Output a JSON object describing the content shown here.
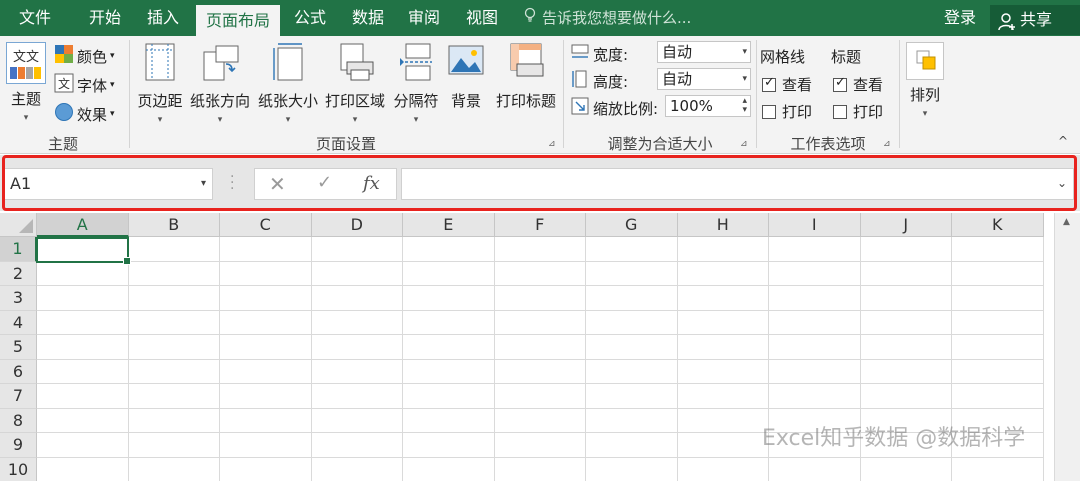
{
  "tabs": [
    {
      "label": "文件",
      "active": false
    },
    {
      "label": "开始",
      "active": false
    },
    {
      "label": "插入",
      "active": false
    },
    {
      "label": "页面布局",
      "active": true
    },
    {
      "label": "公式",
      "active": false
    },
    {
      "label": "数据",
      "active": false
    },
    {
      "label": "审阅",
      "active": false
    },
    {
      "label": "视图",
      "active": false
    }
  ],
  "tell_me": "告诉我您想要做什么...",
  "login": "登录",
  "share": "共享",
  "ribbon": {
    "themes": {
      "theme_label": "主题",
      "colors_label": "颜色",
      "fonts_label": "字体",
      "effects_label": "效果",
      "group_label": "主题",
      "theme_icon_text": "文文"
    },
    "page_setup": {
      "buttons": [
        "页边距",
        "纸张方向",
        "纸张大小",
        "打印区域",
        "分隔符",
        "背景",
        "打印标题"
      ],
      "group_label": "页面设置"
    },
    "scale_to_fit": {
      "width_label": "宽度:",
      "width_value": "自动",
      "height_label": "高度:",
      "height_value": "自动",
      "scale_label": "缩放比例:",
      "scale_value": "100%",
      "group_label": "调整为合适大小"
    },
    "sheet_options": {
      "gridlines_label": "网格线",
      "headings_label": "标题",
      "gridlines_view": "查看",
      "gridlines_print": "打印",
      "headings_view": "查看",
      "headings_print": "打印",
      "gridlines_view_checked": true,
      "gridlines_print_checked": false,
      "headings_view_checked": true,
      "headings_print_checked": false,
      "group_label": "工作表选项"
    },
    "arrange": {
      "label": "排列"
    }
  },
  "formula_bar": {
    "name_box": "A1",
    "formula": ""
  },
  "columns": [
    "A",
    "B",
    "C",
    "D",
    "E",
    "F",
    "G",
    "H",
    "I",
    "J",
    "K"
  ],
  "rows": [
    "1",
    "2",
    "3",
    "4",
    "5",
    "6",
    "7",
    "8",
    "9",
    "10"
  ],
  "active_cell": "A1",
  "colors": {
    "accent": "#217346",
    "highlight_frame": "#e8231e"
  },
  "watermark": "Excel知乎数据 @数据科学"
}
